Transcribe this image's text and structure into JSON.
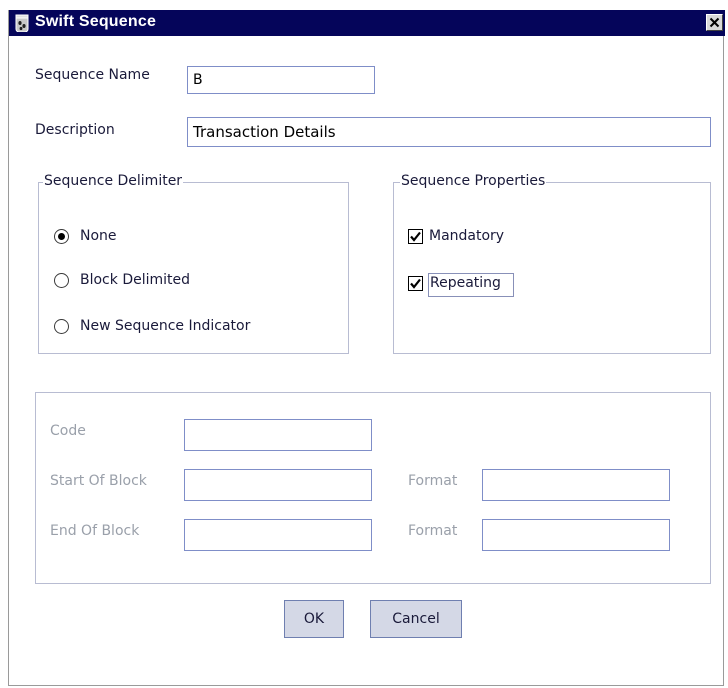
{
  "window": {
    "title": "Swift Sequence",
    "close_icon": "close-icon",
    "app_icon": "bean-jar-icon",
    "title_bar_color": "#05055a"
  },
  "form": {
    "sequence_name_label": "Sequence Name",
    "sequence_name_value": "B",
    "description_label": "Description",
    "description_value": "Transaction Details"
  },
  "delimiter_group": {
    "title": "Sequence Delimiter",
    "options": [
      {
        "label": "None",
        "selected": true
      },
      {
        "label": "Block Delimited",
        "selected": false
      },
      {
        "label": "New Sequence Indicator",
        "selected": false
      }
    ]
  },
  "properties_group": {
    "title": "Sequence Properties",
    "mandatory_label": "Mandatory",
    "mandatory_checked": true,
    "repeating_label": "Repeating",
    "repeating_checked": true
  },
  "block_group": {
    "code_label": "Code",
    "code_value": "",
    "start_label": "Start Of Block",
    "start_value": "",
    "start_format_label": "Format",
    "start_format_value": "",
    "end_label": "End Of Block",
    "end_value": "",
    "end_format_label": "Format",
    "end_format_value": ""
  },
  "buttons": {
    "ok_label": "OK",
    "cancel_label": "Cancel"
  }
}
